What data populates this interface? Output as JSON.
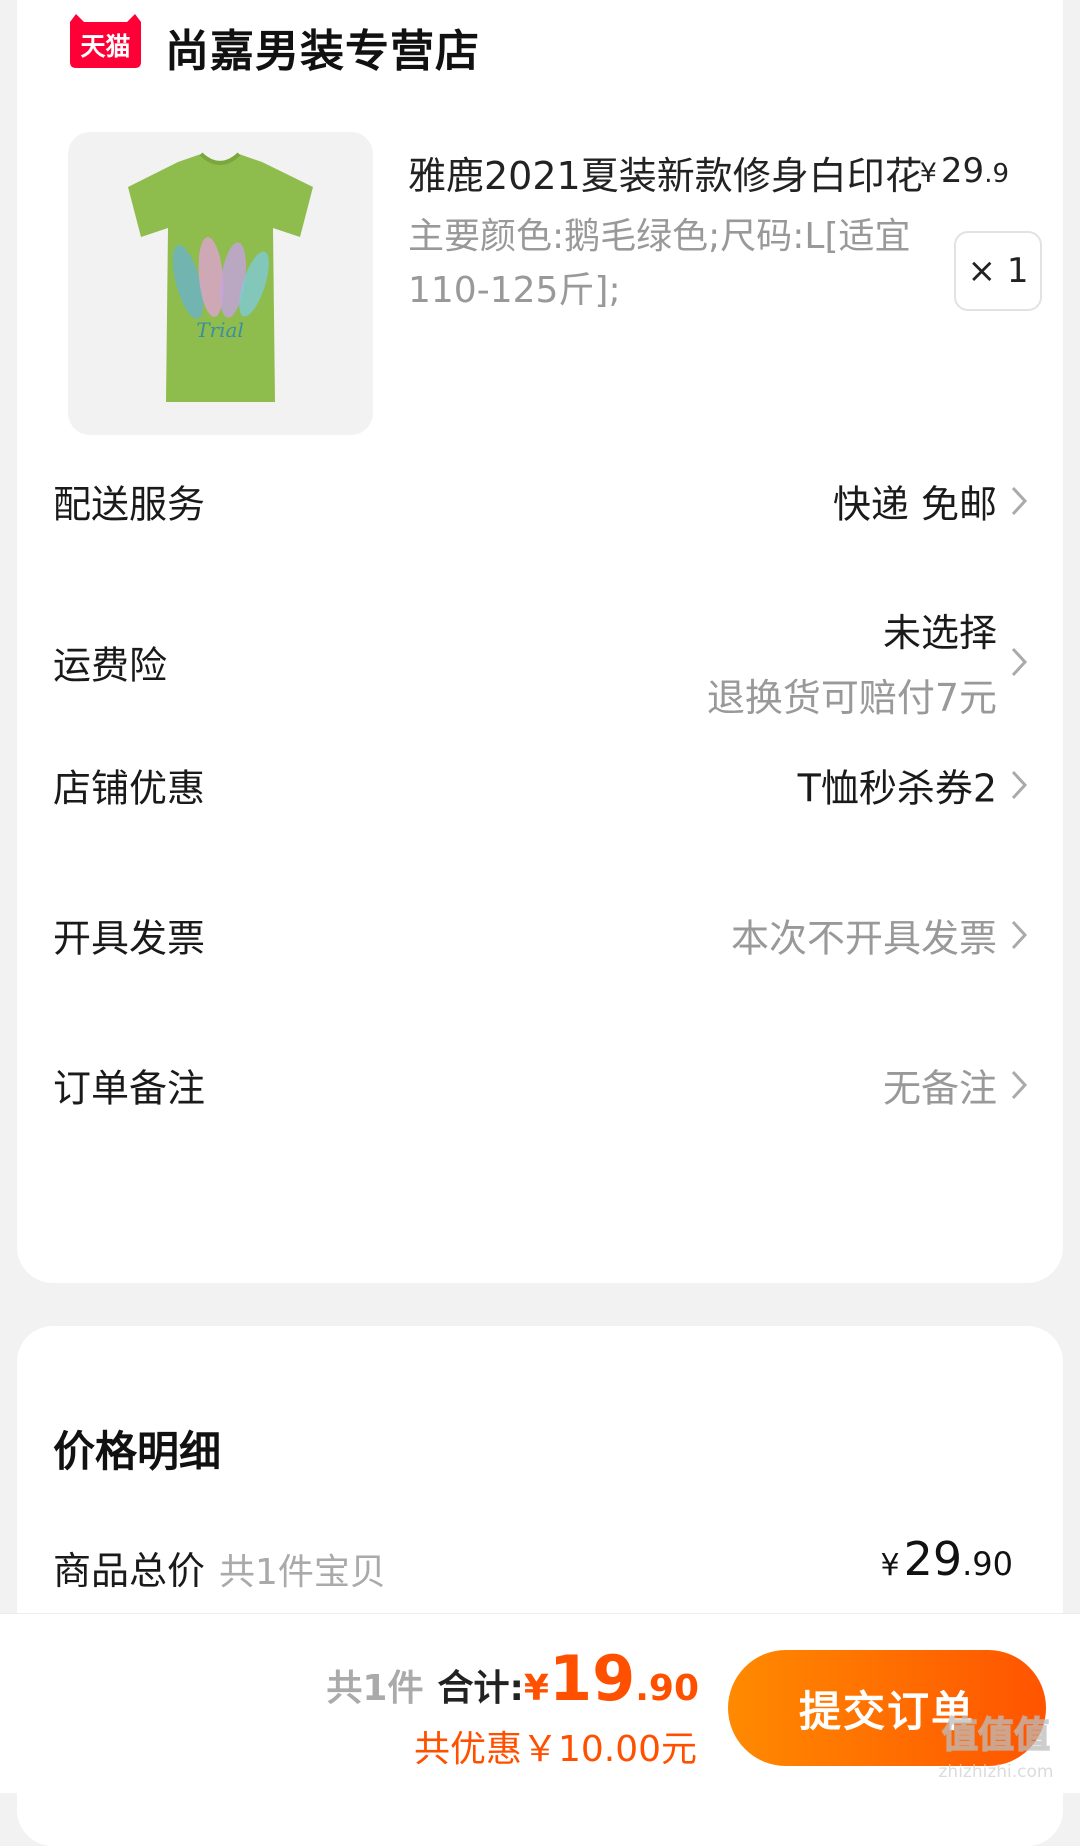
{
  "shop": {
    "logo_text": "天猫",
    "name": "尚嘉男装专营店"
  },
  "product": {
    "title": "雅鹿2021夏装新款修身白印花",
    "price_currency": "¥",
    "price_int": "29",
    "price_dec": ".9",
    "spec": "主要颜色:鹅毛绿色;尺码:L[适宜110-125斤];",
    "quantity": "× 1",
    "image_icon": "green-tshirt-image"
  },
  "options": [
    {
      "label": "配送服务",
      "value": "快递 免邮",
      "muted": false
    },
    {
      "label": "运费险",
      "value": "未选择",
      "sub": "退换货可赔付7元",
      "muted": false
    },
    {
      "label": "店铺优惠",
      "value": "T恤秒杀券2",
      "muted": false
    },
    {
      "label": "开具发票",
      "value": "本次不开具发票",
      "muted": true
    },
    {
      "label": "订单备注",
      "value": "无备注",
      "muted": true
    }
  ],
  "price_detail": {
    "heading": "价格明细",
    "total_label": "商品总价",
    "total_count": "共1件宝贝",
    "total_currency": "¥",
    "total_int": "29",
    "total_dec": ".90"
  },
  "bottom_bar": {
    "count": "共1件",
    "sum_label": "合计:",
    "sum_currency": "¥",
    "sum_int": "19",
    "sum_dec": ".90",
    "discount": "共优惠￥10.00元",
    "submit_label": "提交订单"
  },
  "watermark": {
    "text": "zhizhizhi.com"
  },
  "colors": {
    "accent": "#ff5000",
    "tmall_red": "#ff0036",
    "tshirt_green": "#8ebc4d"
  }
}
